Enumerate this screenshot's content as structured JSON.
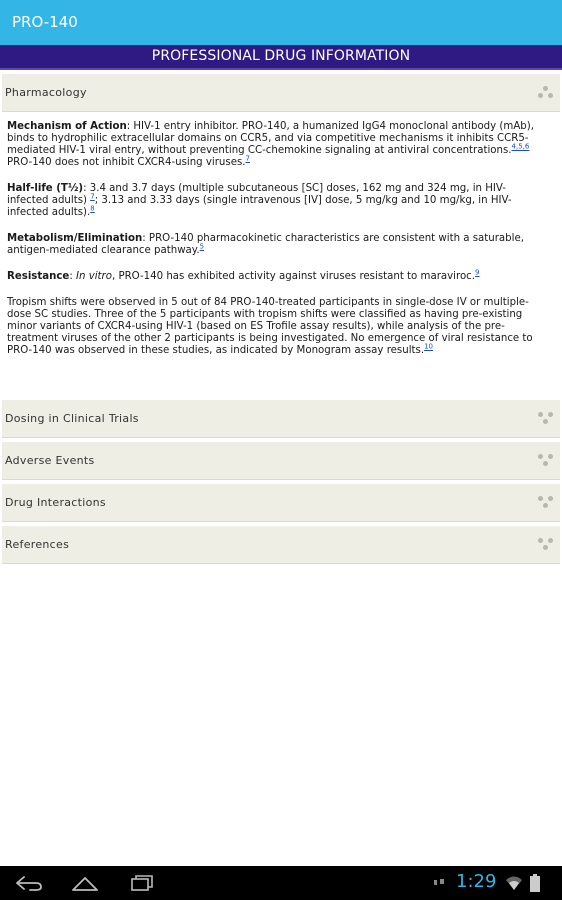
{
  "app": {
    "title": "PRO-140"
  },
  "banner": {
    "text": "PROFESSIONAL DRUG INFORMATION"
  },
  "sections": {
    "pharmacology": "Pharmacology",
    "dosing": "Dosing in Clinical Trials",
    "adverse": "Adverse Events",
    "interactions": "Drug Interactions",
    "references": "References"
  },
  "content": {
    "moa_label": "Mechanism of Action",
    "moa_text_1": ": HIV-1 entry inhibitor. PRO-140, a humanized IgG4 monoclonal antibody (mAb), binds to hydrophilic extracellular domains on CCR5, and via competitive mechanisms it inhibits CCR5-mediated HIV-1 viral entry, without preventing CC-chemokine signaling at antiviral concentrations.",
    "moa_ref_1": "4,5,6",
    "moa_text_2": " PRO-140 does not inhibit CXCR4-using viruses.",
    "moa_ref_2": "7",
    "halflife_label": "Half-life (T½)",
    "halflife_text_1": ": 3.4 and 3.7 days (multiple subcutaneous [SC] doses, 162 mg and 324 mg, in HIV-infected adults) ",
    "halflife_ref_1": "7",
    "halflife_text_2": "; 3.13 and 3.33 days (single intravenous [IV] dose, 5 mg/kg and 10 mg/kg, in HIV-infected adults).",
    "halflife_ref_2": "8",
    "metab_label": "Metabolism/Elimination",
    "metab_text": ": PRO-140 pharmacokinetic characteristics are consistent with a saturable, antigen-mediated clearance pathway.",
    "metab_ref": "5",
    "resist_label": "Resistance",
    "resist_text_1": ": ",
    "resist_italic": "In vitro",
    "resist_text_2": ", PRO-140 has exhibited activity against viruses resistant to maraviroc.",
    "resist_ref": "9",
    "tropism_text": "Tropism shifts were observed in 5 out of 84 PRO-140-treated participants in single-dose IV or multiple-dose SC studies. Three of the 5 participants with tropism shifts were classified as having pre-existing minor variants of CXCR4-using HIV-1 (based on ES Trofile assay results), while analysis of the pre-treatment viruses of the other 2 participants is being investigated. No emergence of viral resistance to PRO-140 was observed in these studies, as indicated by Monogram assay results.",
    "tropism_ref": "10"
  },
  "navbar": {
    "time": "1:29",
    "icons": [
      "back-icon",
      "home-icon",
      "recent-apps-icon",
      "notification-icon",
      "wifi-icon",
      "battery-icon"
    ]
  },
  "colors": {
    "appbar": "#33b5e5",
    "banner": "#2e1a82",
    "section_bg": "#efeee4",
    "link": "#1a4fc8"
  }
}
